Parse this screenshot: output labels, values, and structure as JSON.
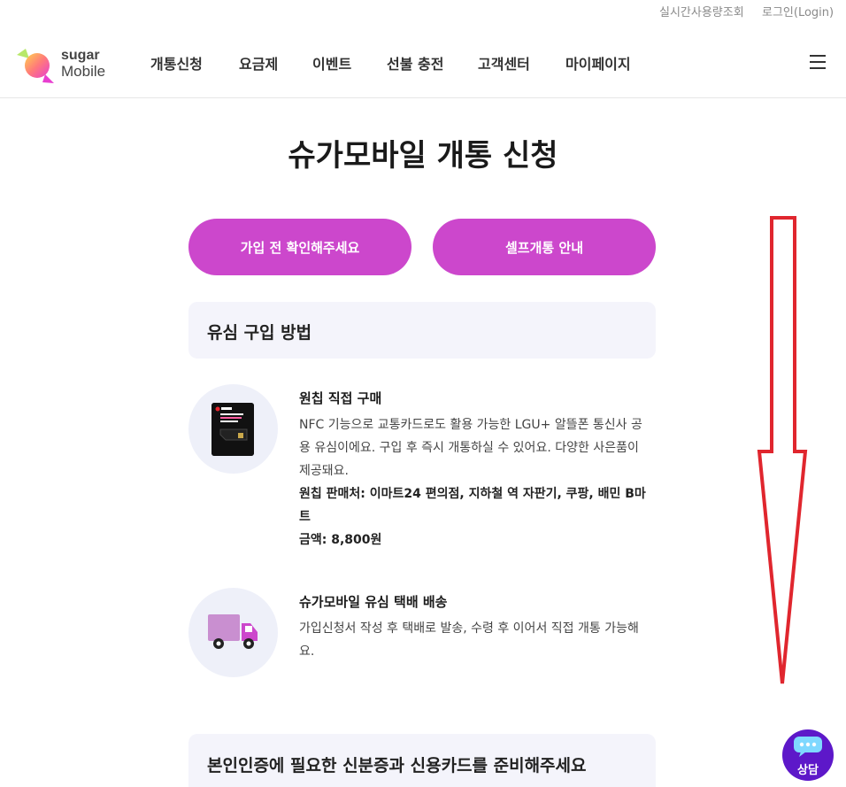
{
  "util": {
    "usage_label": "실시간사용량조회",
    "login_label": "로그인(Login)"
  },
  "brand": {
    "line1": "sugar",
    "line2": "Mobile",
    "accent_color": "#cc47cc"
  },
  "nav": {
    "items": [
      "개통신청",
      "요금제",
      "이벤트",
      "선불 충전",
      "고객센터",
      "마이페이지"
    ],
    "menu_icon": "hamburger-icon"
  },
  "page": {
    "title": "슈가모바일 개통 신청"
  },
  "buttons": {
    "check_before": "가입 전 확인해주세요",
    "self_activation": "셀프개통 안내"
  },
  "sections": {
    "usim_purchase": "유심 구입 방법",
    "id_prepare": "본인인증에 필요한 신분증과 신용카드를 준비해주세요"
  },
  "items": [
    {
      "icon": "sim-card-icon",
      "title": "원칩 직접 구매",
      "desc": "NFC 기능으로 교통카드로도 활용 가능한 LGU+ 알뜰폰 통신사 공용 유심이에요. 구입 후 즉시 개통하실 수 있어요. 다양한 사은품이 제공돼요.",
      "sellers": "원칩 판매처: 이마트24 편의점, 지하철 역 자판기, 쿠팡, 배민 B마트",
      "price": "금액: 8,800원"
    },
    {
      "icon": "truck-icon",
      "title": "슈가모바일 유심 택배 배송",
      "desc": "가입신청서 작성 후 택배로 발송, 수령 후 이어서 직접 개통 가능해요."
    }
  ],
  "chat": {
    "label": "상담",
    "icon": "chat-bubble-icon"
  }
}
